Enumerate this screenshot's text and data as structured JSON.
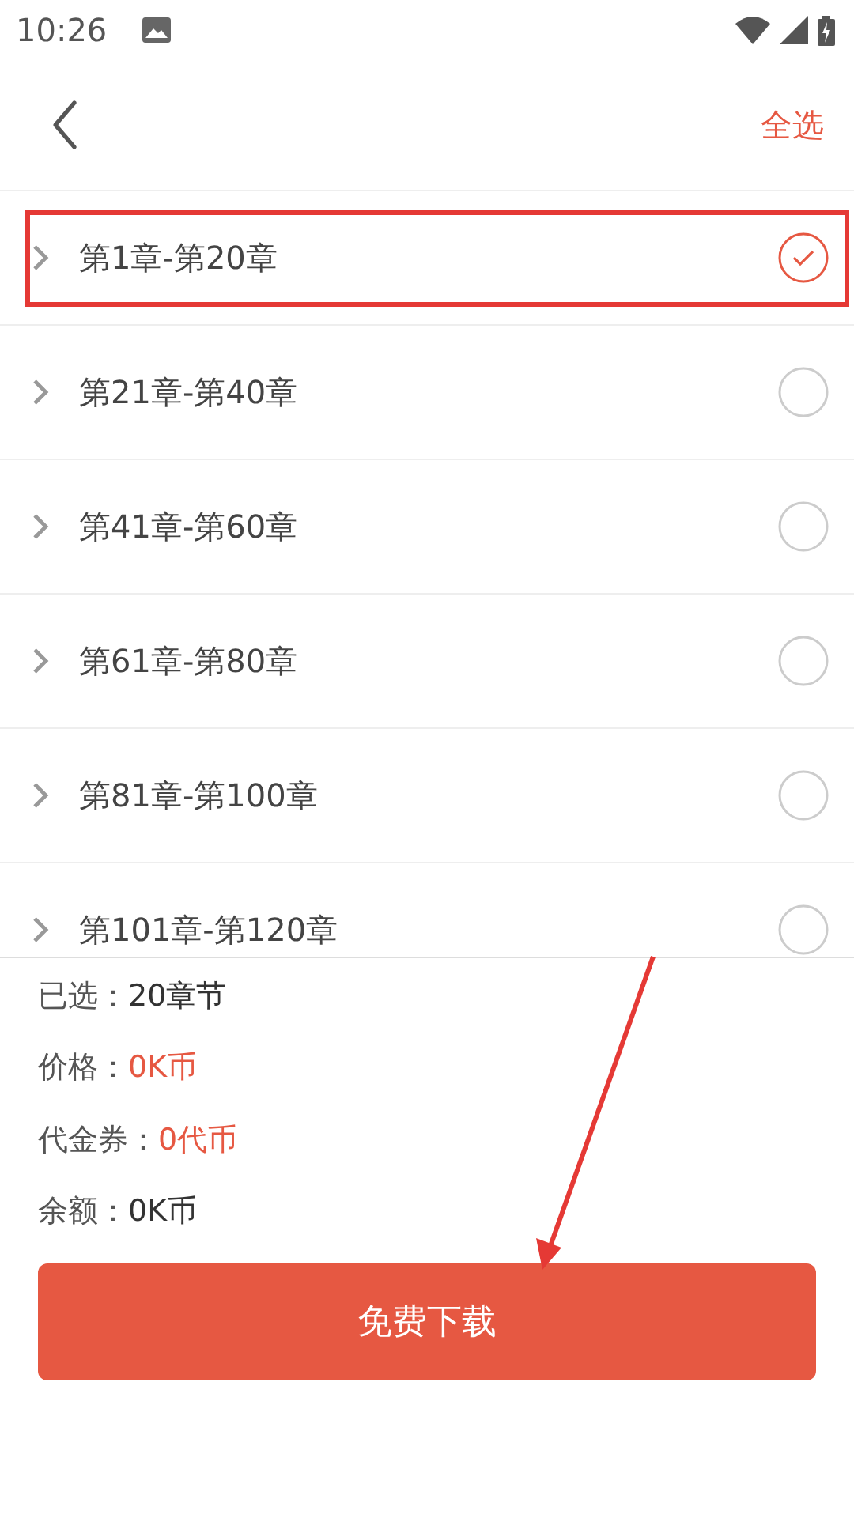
{
  "status_bar": {
    "time": "10:26"
  },
  "header": {
    "select_all": "全选"
  },
  "chapters": [
    {
      "label": "第1章-第20章",
      "selected": true,
      "highlighted": true
    },
    {
      "label": "第21章-第40章",
      "selected": false,
      "highlighted": false
    },
    {
      "label": "第41章-第60章",
      "selected": false,
      "highlighted": false
    },
    {
      "label": "第61章-第80章",
      "selected": false,
      "highlighted": false
    },
    {
      "label": "第81章-第100章",
      "selected": false,
      "highlighted": false
    },
    {
      "label": "第101章-第120章",
      "selected": false,
      "highlighted": false
    }
  ],
  "summary": [
    {
      "label": "已选：",
      "value": "20章节",
      "accent": false
    },
    {
      "label": "价格：",
      "value": "0K币",
      "accent": true
    },
    {
      "label": "代金券：",
      "value": "0代币",
      "accent": true
    },
    {
      "label": "余额：",
      "value": "0K币",
      "accent": false
    }
  ],
  "download_button": "免费下载",
  "annotation_arrow": true
}
